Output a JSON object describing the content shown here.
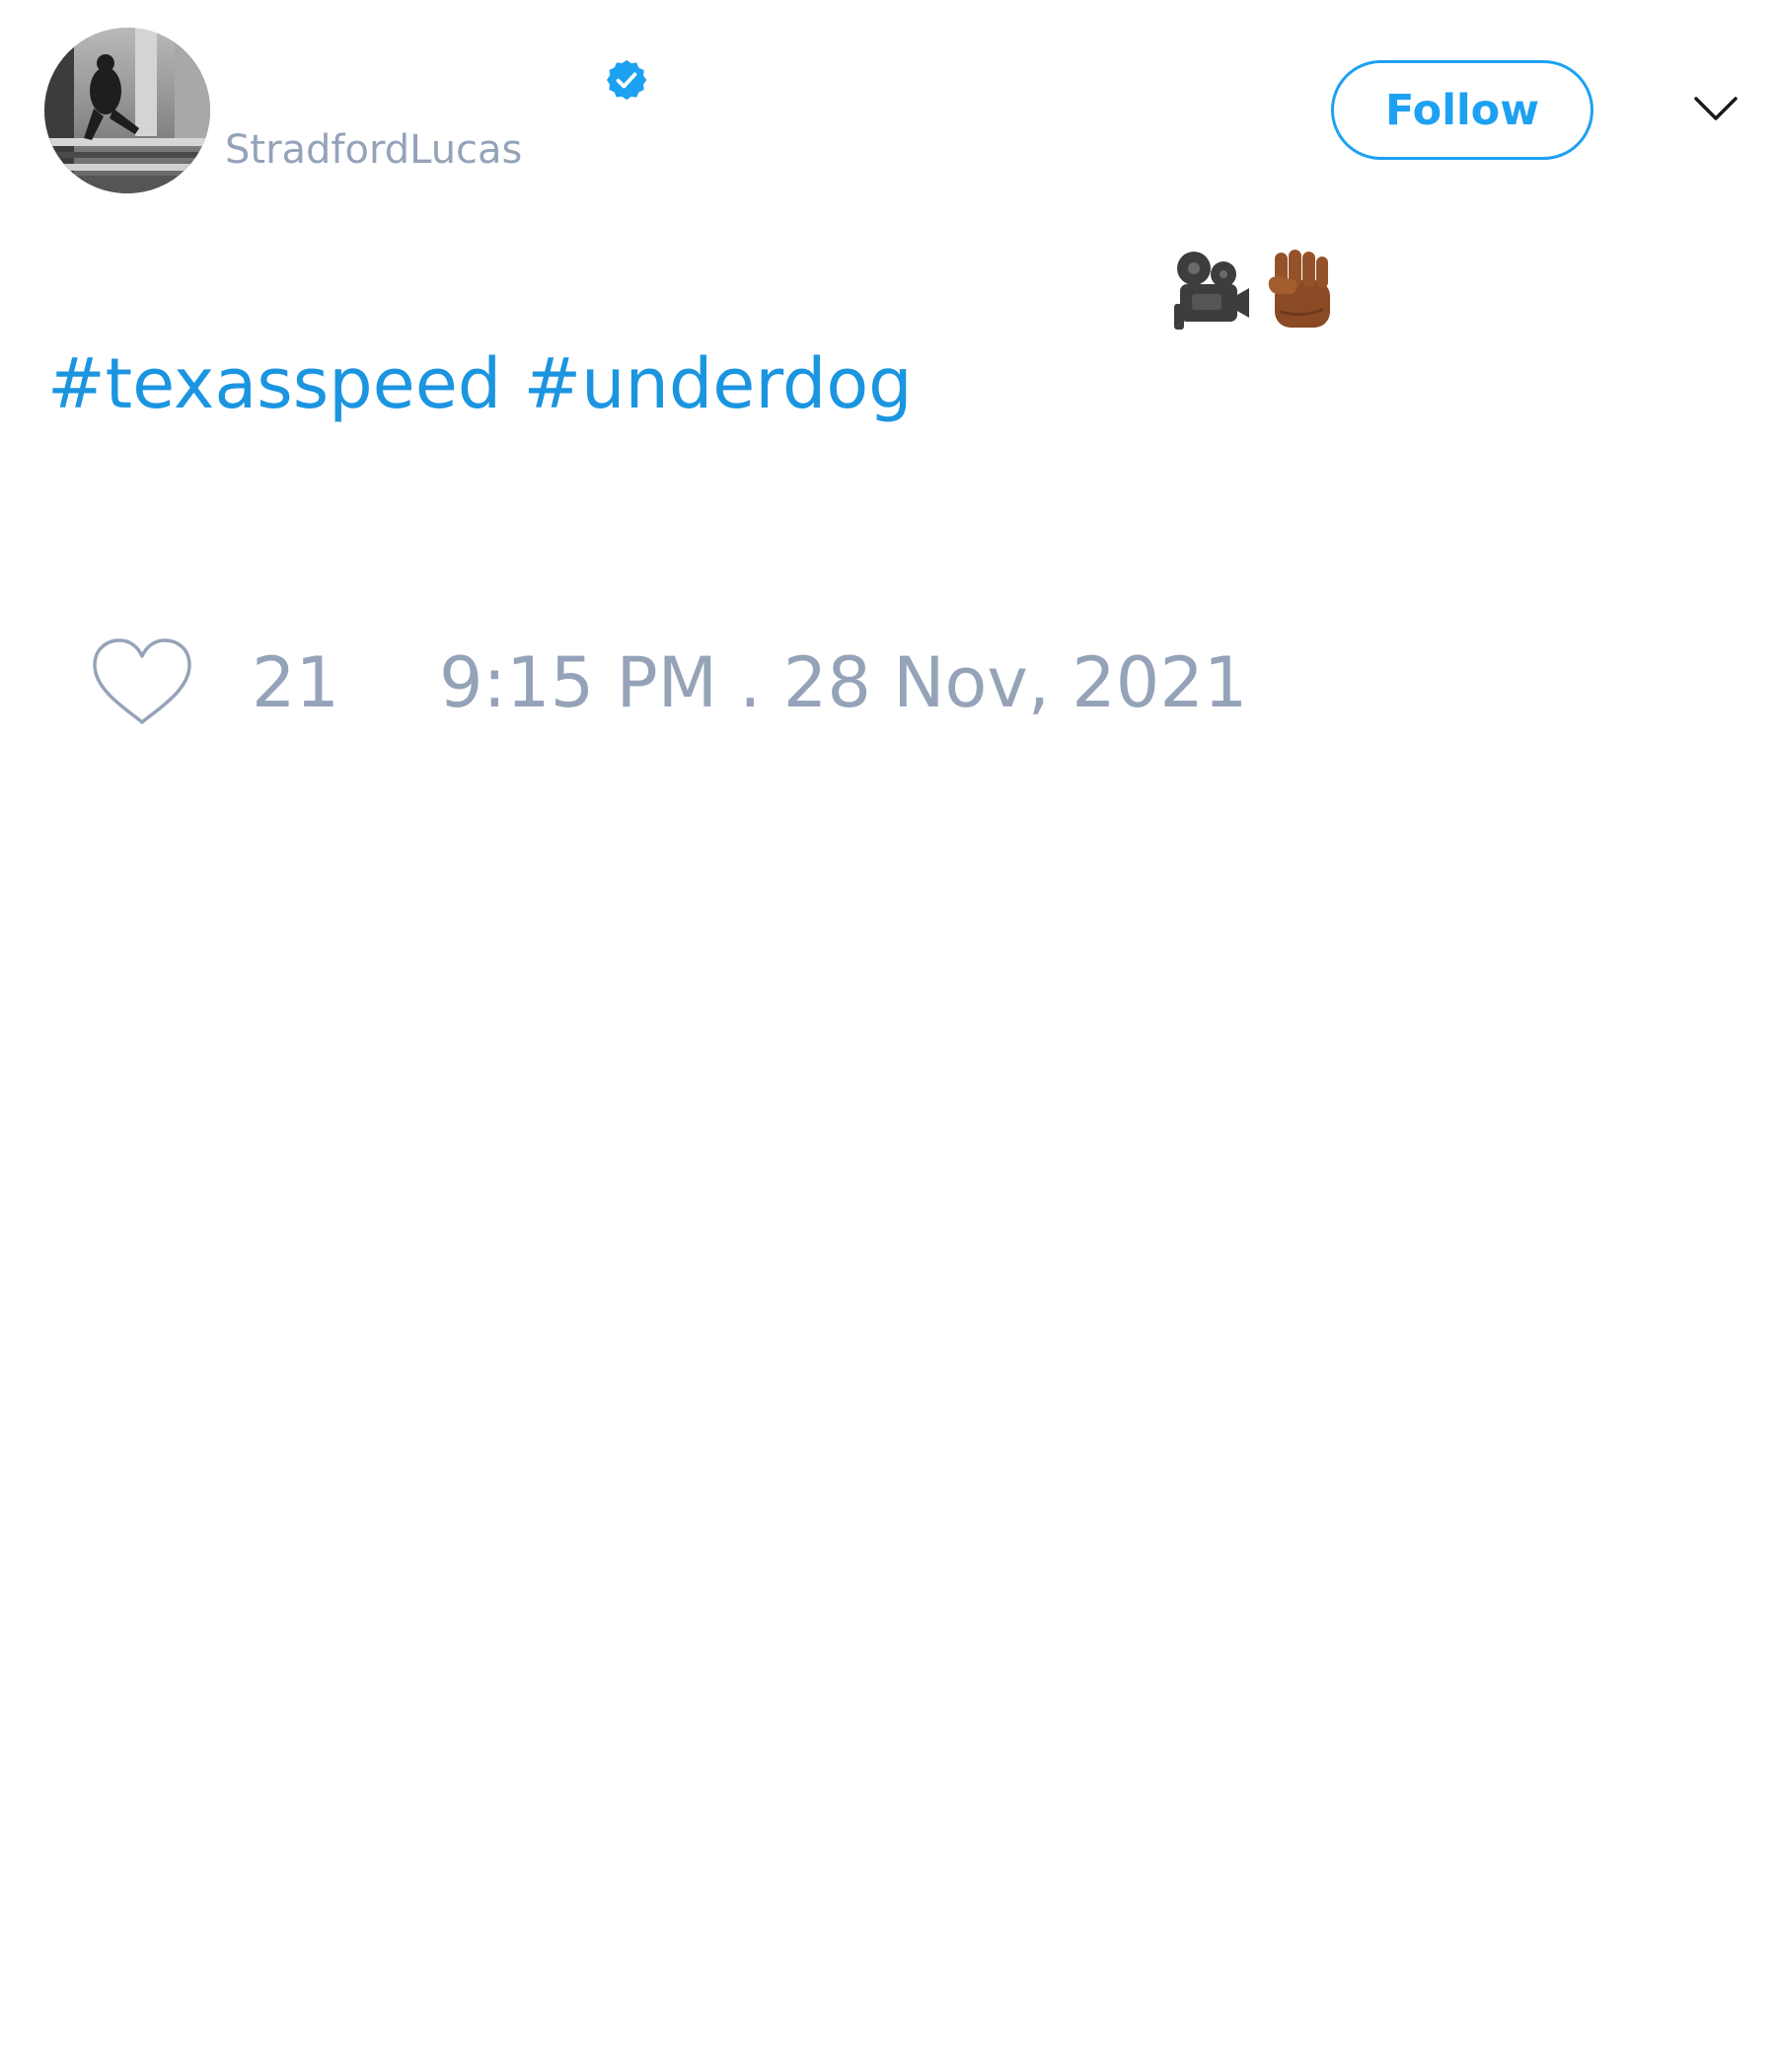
{
  "tweet": {
    "author": {
      "handle": "StradfordLucas",
      "verified_icon": "verified-badge-icon",
      "avatar": "profile-photo"
    },
    "follow_label": "Follow",
    "menu_icon": "chevron-down-icon",
    "emojis": [
      "movie-camera-icon",
      "raised-fist-icon"
    ],
    "hashtags": [
      "#texasspeed",
      "#underdog"
    ],
    "like_icon": "heart-icon",
    "like_count": "21",
    "timestamp": "9:15 PM . 28 Nov, 2021"
  },
  "colors": {
    "accent": "#1da1f2",
    "link": "#1b95e0",
    "muted": "#95a3b9",
    "background": "#ffffff"
  }
}
